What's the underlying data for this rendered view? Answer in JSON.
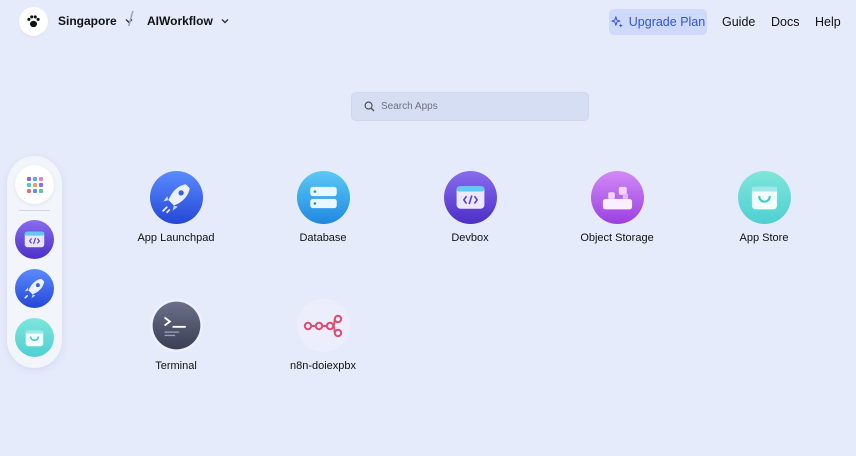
{
  "header": {
    "region": "Singapore",
    "workspace": "AIWorkflow",
    "upgrade_label": "Upgrade Plan",
    "links": [
      "Guide",
      "Docs",
      "Help"
    ]
  },
  "search": {
    "placeholder": "Search Apps"
  },
  "dock": {
    "items": [
      "apps-grid-icon",
      "devbox-icon",
      "launchpad-rocket-icon",
      "app-store-bag-icon"
    ]
  },
  "apps": [
    {
      "label": "App Launchpad",
      "icon": "rocket-icon"
    },
    {
      "label": "Database",
      "icon": "database-icon"
    },
    {
      "label": "Devbox",
      "icon": "code-window-icon"
    },
    {
      "label": "Object Storage",
      "icon": "storage-blocks-icon"
    },
    {
      "label": "App Store",
      "icon": "shopping-bag-icon"
    },
    {
      "label": "Terminal",
      "icon": "terminal-icon"
    },
    {
      "label": "n8n-doiexpbx",
      "icon": "n8n-icon"
    }
  ],
  "colors": {
    "background": "#e6ebfb",
    "accent": "#2f55d4",
    "upgrade_bg": "#cfd9fb"
  }
}
